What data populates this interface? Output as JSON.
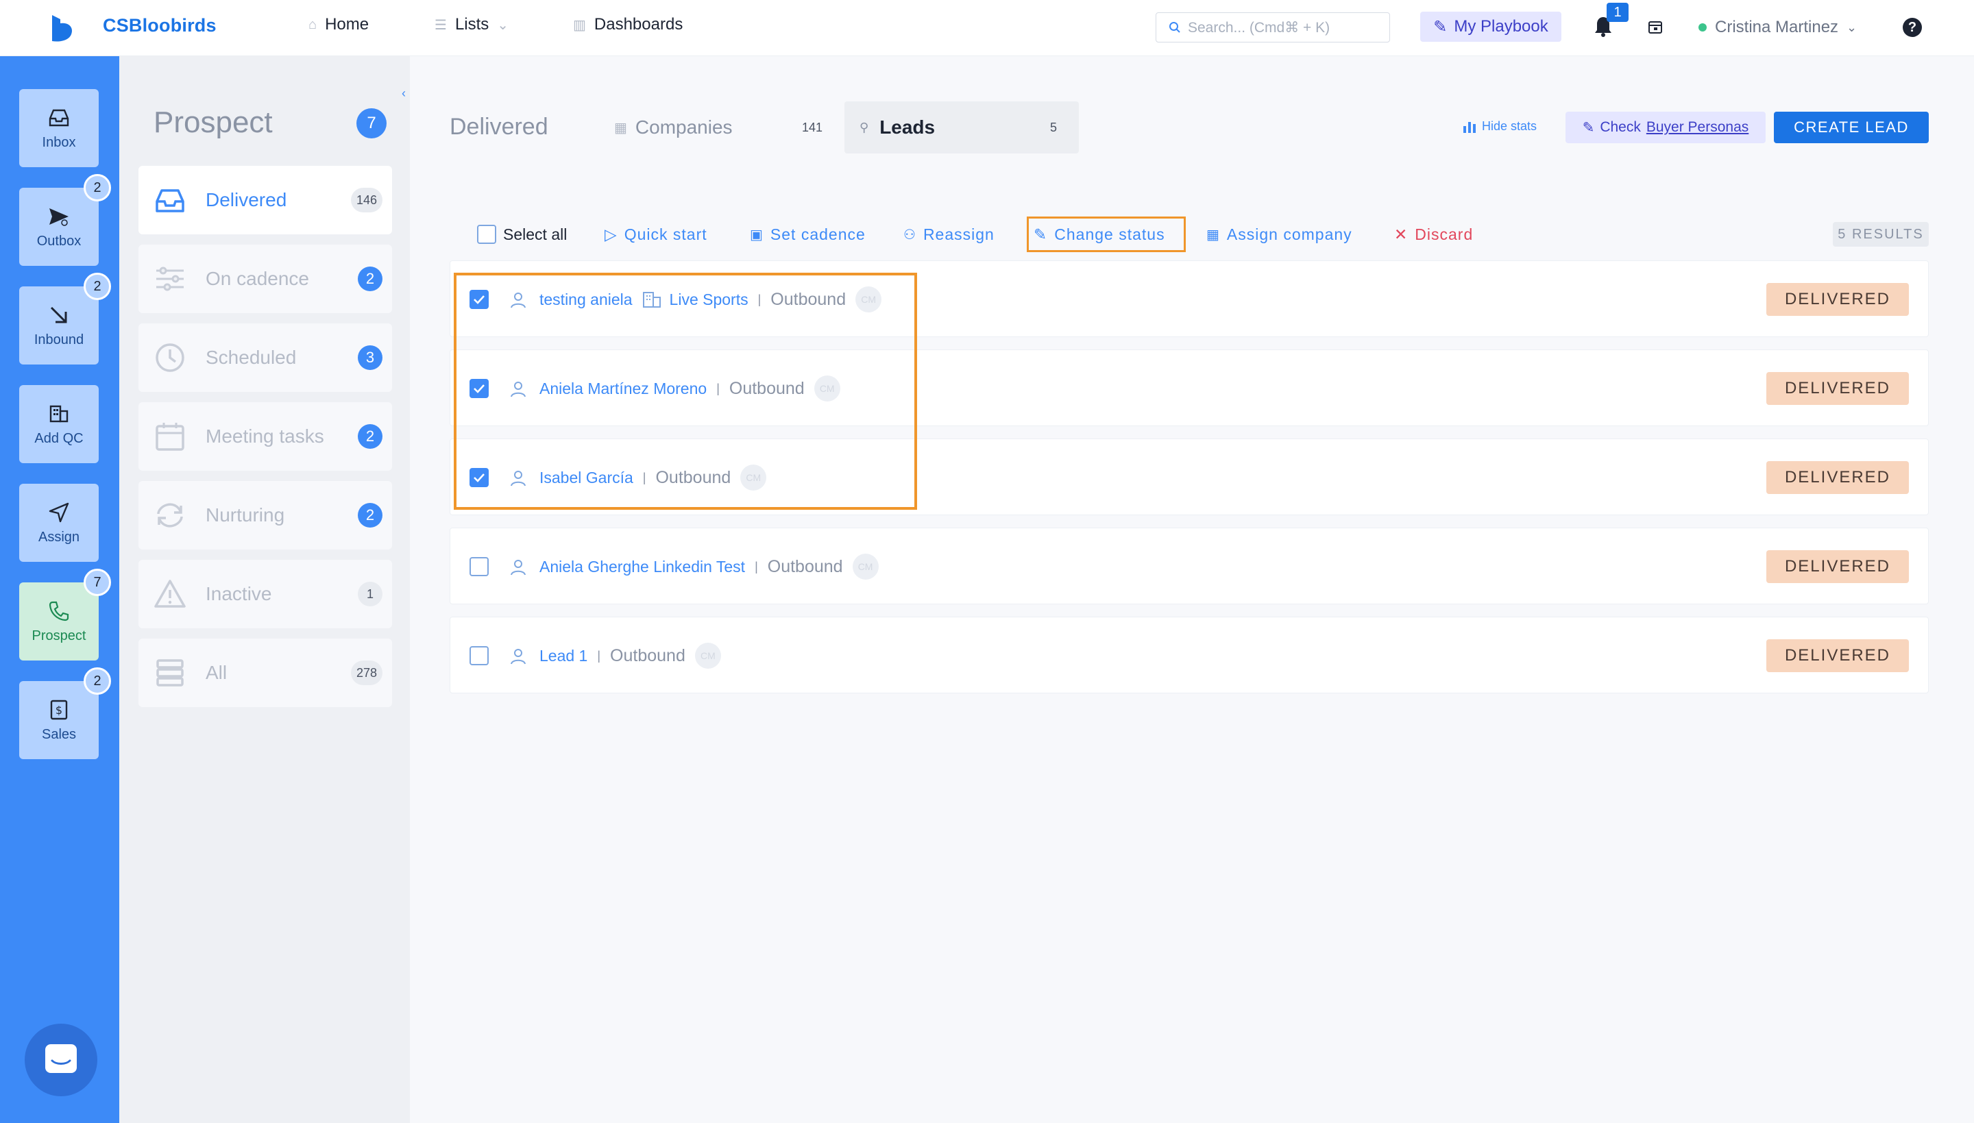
{
  "header": {
    "brand": "CSBloobirds",
    "nav": [
      {
        "label": "Home",
        "icon": "home-icon"
      },
      {
        "label": "Lists",
        "icon": "list-icon"
      },
      {
        "label": "Dashboards",
        "icon": "chart-icon"
      }
    ],
    "search_placeholder": "Search... (Cmd⌘ + K)",
    "playbook_label": "My Playbook",
    "notifications_count": "1",
    "user_name": "Cristina Martinez",
    "help_label": "?"
  },
  "rail": [
    {
      "label": "Inbox",
      "badge": ""
    },
    {
      "label": "Outbox",
      "badge": "2"
    },
    {
      "label": "Inbound",
      "badge": "2"
    },
    {
      "label": "Add QC",
      "badge": ""
    },
    {
      "label": "Assign",
      "badge": ""
    },
    {
      "label": "Prospect",
      "badge": "7"
    },
    {
      "label": "Sales",
      "badge": "2"
    }
  ],
  "sidebar": {
    "title": "Prospect",
    "count": "7",
    "items": [
      {
        "label": "Delivered",
        "count": "146"
      },
      {
        "label": "On cadence",
        "count": "2"
      },
      {
        "label": "Scheduled",
        "count": "3"
      },
      {
        "label": "Meeting tasks",
        "count": "2"
      },
      {
        "label": "Nurturing",
        "count": "2"
      },
      {
        "label": "Inactive",
        "count": "1"
      },
      {
        "label": "All",
        "count": "278"
      }
    ]
  },
  "main": {
    "title": "Delivered",
    "tabs": [
      {
        "label": "Companies",
        "count": "141"
      },
      {
        "label": "Leads",
        "count": "5"
      }
    ],
    "hide_stats": "Hide stats",
    "buyer_prefix": "Check",
    "buyer_link": "Buyer Personas",
    "create_label": "CREATE LEAD",
    "toolbar": {
      "select_all": "Select all",
      "quick_start": "Quick start",
      "set_cadence": "Set cadence",
      "reassign": "Reassign",
      "change_status": "Change status",
      "assign_company": "Assign company",
      "discard": "Discard"
    },
    "results": "5 RESULTS",
    "rows": [
      {
        "name": "testing aniela",
        "company": "Live Sports",
        "source": "Outbound",
        "avatar": "CM",
        "status": "DELIVERED",
        "checked": true
      },
      {
        "name": "Aniela Martínez Moreno",
        "company": "",
        "source": "Outbound",
        "avatar": "CM",
        "status": "DELIVERED",
        "checked": true
      },
      {
        "name": "Isabel García",
        "company": "",
        "source": "Outbound",
        "avatar": "CM",
        "status": "DELIVERED",
        "checked": true
      },
      {
        "name": "Aniela Gherghe Linkedin Test",
        "company": "",
        "source": "Outbound",
        "avatar": "CM",
        "status": "DELIVERED",
        "checked": false
      },
      {
        "name": "Lead 1",
        "company": "",
        "source": "Outbound",
        "avatar": "CM",
        "status": "DELIVERED",
        "checked": false
      }
    ]
  },
  "colors": {
    "primary": "#3d8af7",
    "accent_highlight": "#f0962b",
    "status_bg": "#f8d5bd"
  }
}
